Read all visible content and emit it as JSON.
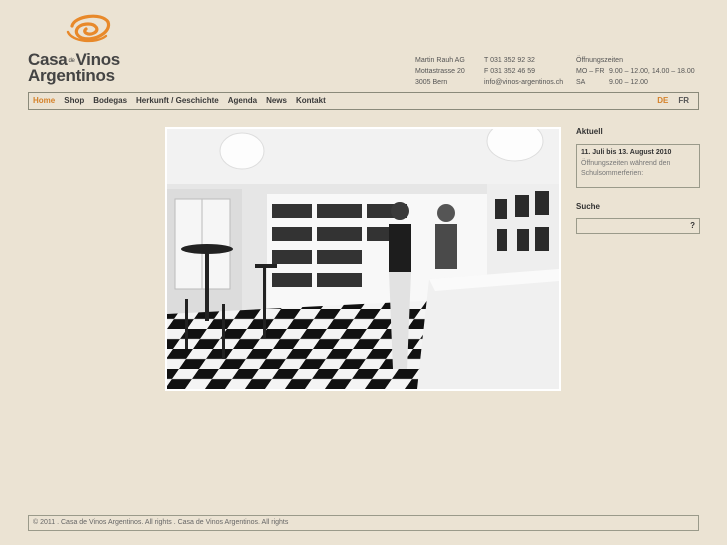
{
  "logo": {
    "word1": "Casa",
    "de": "de",
    "word2": "Vinos",
    "word3": "Argentinos",
    "accent_color": "#e8892a"
  },
  "contact": {
    "address": [
      "Martin Rauh AG",
      "Mottastrasse 20",
      "3005 Bern"
    ],
    "phone": [
      "T 031 352 92 32",
      "F 031 352 46 59",
      "info@vinos-argentinos.ch"
    ],
    "hours_title": "Öffnungszeiten",
    "hours": [
      {
        "day": "MO – FR",
        "time": "9.00 – 12.00, 14.00 – 18.00"
      },
      {
        "day": "SA",
        "time": "9.00 – 12.00"
      }
    ]
  },
  "nav": {
    "items": [
      {
        "label": "Home",
        "active": true
      },
      {
        "label": "Shop",
        "active": false
      },
      {
        "label": "Bodegas",
        "active": false
      },
      {
        "label": "Herkunft / Geschichte",
        "active": false
      },
      {
        "label": "Agenda",
        "active": false
      },
      {
        "label": "News",
        "active": false
      },
      {
        "label": "Kontakt",
        "active": false
      }
    ],
    "languages": [
      {
        "label": "DE",
        "active": true
      },
      {
        "label": "FR",
        "active": false
      }
    ],
    "active_color": "#d5822a"
  },
  "sidebar": {
    "news_title": "Aktuell",
    "news_date": "11. Juli bis 13. August 2010",
    "news_text": "Öffnungszeiten während den Schulsommerferien:",
    "search_title": "Suche",
    "search_placeholder": "",
    "search_button": "?"
  },
  "footer": {
    "text": "© 2011 . Casa de Vinos Argentinos. All rights . Casa de Vinos Argentinos. All rights"
  }
}
